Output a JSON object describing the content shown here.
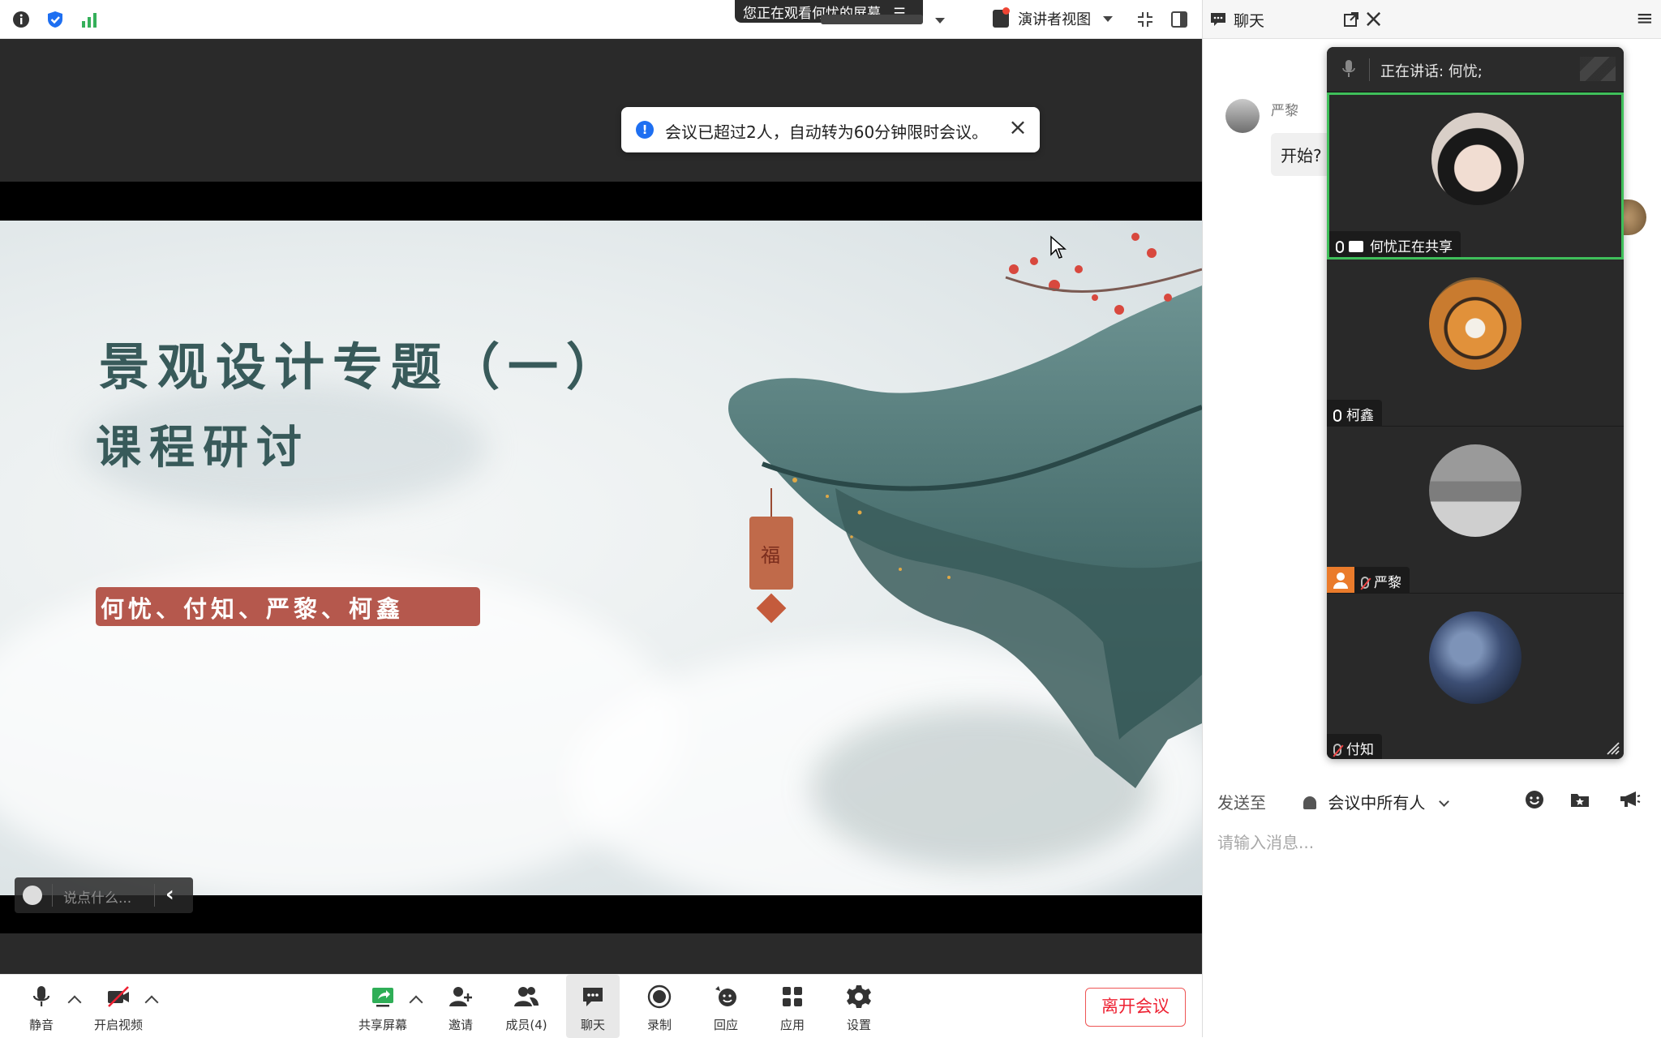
{
  "top_bar": {
    "info_icon": "info-icon",
    "shield_icon": "shield-icon",
    "signal_icon": "signal-bars-icon",
    "watch_banner": "您正在观看何忧的屏幕",
    "view_option": "演讲者视图",
    "colors": {
      "shield": "#1e6ff1",
      "signal": "#35b05a"
    }
  },
  "notice": {
    "text": "会议已超过2人，自动转为60分钟限时会议。",
    "close_icon": "close-icon"
  },
  "slide": {
    "title_line1": "景观设计专题（一）",
    "title_line2": "课程研讨",
    "names": "何忧、付知、严黎、柯鑫",
    "lantern_char": "福",
    "colors": {
      "title": "#385a5a",
      "band": "#b5584d",
      "roof": "#3f6a6b"
    }
  },
  "say_bar": {
    "placeholder": "说点什么..."
  },
  "toolbar": {
    "mute": "静音",
    "video": "开启视频",
    "share": "共享屏幕",
    "invite": "邀请",
    "members": "成员(4)",
    "chat": "聊天",
    "record": "录制",
    "reactions": "回应",
    "apps": "应用",
    "settings": "设置",
    "leave": "离开会议"
  },
  "chat": {
    "title": "聊天",
    "messages": [
      {
        "sender": "严黎",
        "text": "开始?"
      }
    ],
    "send_to_label": "发送至",
    "send_to_target": "会议中所有人",
    "input_placeholder": "请输入消息..."
  },
  "gallery": {
    "speaking": "正在讲话:  何忧;",
    "participants": [
      {
        "name": "何忧正在共享",
        "mic": "on",
        "sharing": true
      },
      {
        "name": "柯鑫",
        "mic": "on",
        "sharing": false
      },
      {
        "name": "严黎",
        "mic": "off",
        "sharing": false
      },
      {
        "name": "付知",
        "mic": "off",
        "sharing": false
      }
    ]
  }
}
